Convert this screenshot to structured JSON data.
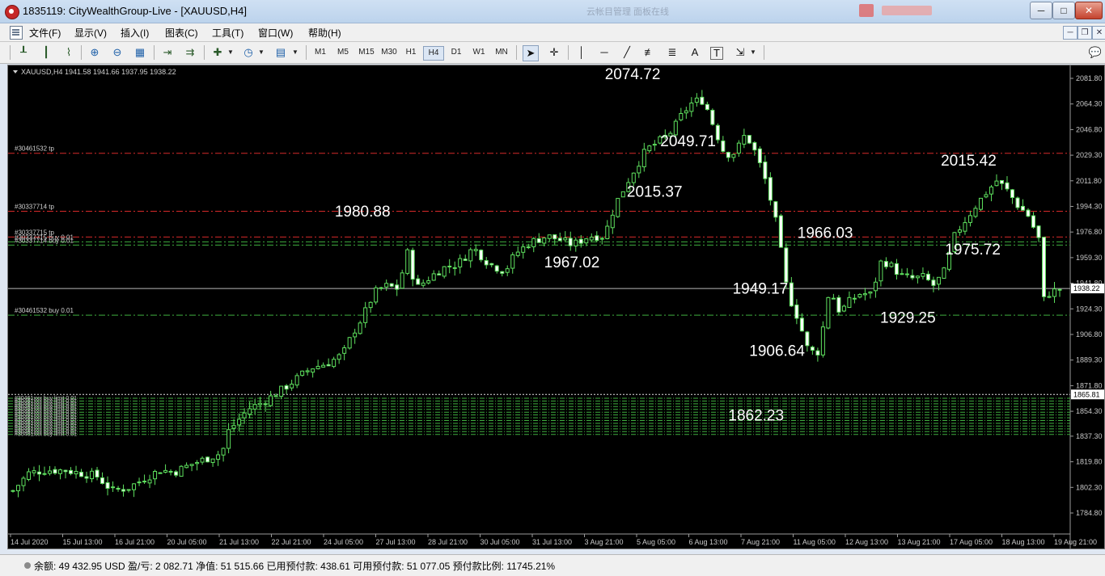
{
  "window": {
    "title": "1835119: CityWealthGroup-Live - [XAUUSD,H4]",
    "ghost_text": "云帐目管理  面板在线"
  },
  "menu": {
    "items": [
      "文件(F)",
      "显示(V)",
      "插入(I)",
      "图表(C)",
      "工具(T)",
      "窗口(W)",
      "帮助(H)"
    ]
  },
  "toolbar": {
    "timeframes": [
      "M1",
      "M5",
      "M15",
      "M30",
      "H1",
      "H4",
      "D1",
      "W1",
      "MN"
    ],
    "active_timeframe": "H4",
    "text_tool": "A",
    "text_label_tool": "T"
  },
  "chart": {
    "symbol_info": "XAUUSD,H4  1941.58 1941.66 1937.95 1938.22",
    "current_price": "1938.22",
    "current_price_value": 1938.22,
    "price_axis_labels": [
      "2081.80",
      "2064.30",
      "2046.80",
      "2029.30",
      "2011.80",
      "1994.30",
      "1976.80",
      "1959.30",
      "1941.80",
      "1924.30",
      "1906.80",
      "1889.30",
      "1871.80",
      "1854.30",
      "1837.30",
      "1819.80",
      "1802.30",
      "1784.80"
    ],
    "time_axis_labels": [
      "14 Jul 2020",
      "15 Jul 13:00",
      "16 Jul 21:00",
      "20 Jul 05:00",
      "21 Jul 13:00",
      "22 Jul 21:00",
      "24 Jul 05:00",
      "27 Jul 13:00",
      "28 Jul 21:00",
      "30 Jul 05:00",
      "31 Jul 13:00",
      "3 Aug 21:00",
      "5 Aug 05:00",
      "6 Aug 13:00",
      "7 Aug 21:00",
      "11 Aug 05:00",
      "12 Aug 13:00",
      "13 Aug 21:00",
      "17 Aug 05:00",
      "18 Aug 13:00",
      "19 Aug 21:00"
    ],
    "order_lines": [
      {
        "label": "#30461532 tp",
        "price": 2030.6,
        "color": "#d62a2a",
        "style": "dashdot"
      },
      {
        "label": "#30337714 tp",
        "price": 1991.0,
        "color": "#d62a2a",
        "style": "dashdot"
      },
      {
        "label": "#30337715 tp",
        "price": 1973.4,
        "color": "#d62a2a",
        "style": "dashdot"
      },
      {
        "label": "#30337715 buy 0.01",
        "price": 1970.1,
        "color": "#3fae3f",
        "style": "dashdot"
      },
      {
        "label": "#30337714 buy 0.01",
        "price": 1967.9,
        "color": "#3fae3f",
        "style": "dashdot"
      },
      {
        "label": "#30461532 buy 0.01",
        "price": 1920.0,
        "color": "#3fae3f",
        "style": "dashdot"
      }
    ],
    "pending_line_price": 1865.81,
    "pending_line_label": "1865.81",
    "limit_orders": {
      "label": "#30461xxx buy limit 0.01",
      "prices": [
        1863.2,
        1861.3,
        1859.4,
        1857.5,
        1855.6,
        1853.7,
        1851.8,
        1849.9,
        1848.0,
        1846.1,
        1844.2,
        1842.3,
        1840.4,
        1838.5
      ]
    },
    "annotations": [
      {
        "text": "2074.72",
        "price": 2074.72,
        "t": 0.592
      },
      {
        "text": "2049.71",
        "price": 2049.71,
        "t": 0.645
      },
      {
        "text": "2015.37",
        "price": 2015.37,
        "t": 0.613
      },
      {
        "text": "1980.88",
        "price": 1980.88,
        "t": 0.334
      },
      {
        "text": "1967.02",
        "price": 1967.02,
        "t": 0.534
      },
      {
        "text": "1966.03",
        "price": 1966.03,
        "t": 0.776
      },
      {
        "text": "1949.17",
        "price": 1949.17,
        "t": 0.714
      },
      {
        "text": "1906.64",
        "price": 1906.64,
        "t": 0.73
      },
      {
        "text": "1862.23",
        "price": 1862.23,
        "t": 0.71
      },
      {
        "text": "2015.42",
        "price": 2015.42,
        "t": 0.913
      },
      {
        "text": "1975.72",
        "price": 1975.72,
        "t": 0.917
      },
      {
        "text": "1929.25",
        "price": 1929.25,
        "t": 0.855
      }
    ]
  },
  "chart_data": {
    "type": "candlestick",
    "symbol": "XAUUSD",
    "timeframe": "H4",
    "ylim": [
      1784.8,
      2081.8
    ],
    "close_path": [
      [
        0.0,
        1800
      ],
      [
        0.015,
        1812
      ],
      [
        0.03,
        1814
      ],
      [
        0.05,
        1814
      ],
      [
        0.065,
        1812
      ],
      [
        0.08,
        1810
      ],
      [
        0.095,
        1800
      ],
      [
        0.11,
        1802
      ],
      [
        0.125,
        1808
      ],
      [
        0.14,
        1814
      ],
      [
        0.155,
        1813
      ],
      [
        0.17,
        1818
      ],
      [
        0.185,
        1822
      ],
      [
        0.2,
        1826
      ],
      [
        0.205,
        1840
      ],
      [
        0.215,
        1848
      ],
      [
        0.225,
        1856
      ],
      [
        0.24,
        1861
      ],
      [
        0.255,
        1868
      ],
      [
        0.27,
        1876
      ],
      [
        0.285,
        1884
      ],
      [
        0.3,
        1887
      ],
      [
        0.315,
        1893
      ],
      [
        0.325,
        1908
      ],
      [
        0.335,
        1920
      ],
      [
        0.345,
        1935
      ],
      [
        0.355,
        1940
      ],
      [
        0.37,
        1938
      ],
      [
        0.375,
        1968
      ],
      [
        0.385,
        1938
      ],
      [
        0.395,
        1944
      ],
      [
        0.41,
        1952
      ],
      [
        0.425,
        1955
      ],
      [
        0.44,
        1966
      ],
      [
        0.455,
        1955
      ],
      [
        0.47,
        1950
      ],
      [
        0.48,
        1962
      ],
      [
        0.495,
        1970
      ],
      [
        0.51,
        1974
      ],
      [
        0.52,
        1972
      ],
      [
        0.535,
        1968
      ],
      [
        0.55,
        1974
      ],
      [
        0.565,
        1974
      ],
      [
        0.575,
        1995
      ],
      [
        0.59,
        2015
      ],
      [
        0.605,
        2033
      ],
      [
        0.62,
        2040
      ],
      [
        0.63,
        2046
      ],
      [
        0.64,
        2058
      ],
      [
        0.65,
        2066
      ],
      [
        0.66,
        2067
      ],
      [
        0.67,
        2048
      ],
      [
        0.68,
        2030
      ],
      [
        0.69,
        2031
      ],
      [
        0.7,
        2044
      ],
      [
        0.71,
        2030
      ],
      [
        0.72,
        2010
      ],
      [
        0.73,
        1980
      ],
      [
        0.74,
        1935
      ],
      [
        0.75,
        1918
      ],
      [
        0.76,
        1895
      ],
      [
        0.77,
        1895
      ],
      [
        0.78,
        1938
      ],
      [
        0.79,
        1922
      ],
      [
        0.8,
        1930
      ],
      [
        0.81,
        1935
      ],
      [
        0.82,
        1934
      ],
      [
        0.83,
        1958
      ],
      [
        0.84,
        1953
      ],
      [
        0.85,
        1946
      ],
      [
        0.86,
        1945
      ],
      [
        0.87,
        1946
      ],
      [
        0.88,
        1940
      ],
      [
        0.89,
        1950
      ],
      [
        0.9,
        1975
      ],
      [
        0.91,
        1985
      ],
      [
        0.92,
        1995
      ],
      [
        0.93,
        2004
      ],
      [
        0.94,
        2012
      ],
      [
        0.95,
        2005
      ],
      [
        0.96,
        1995
      ],
      [
        0.97,
        1988
      ],
      [
        0.98,
        1972
      ],
      [
        0.985,
        1930
      ],
      [
        0.99,
        1935
      ],
      [
        1.0,
        1938
      ]
    ]
  },
  "statusbar": {
    "text": "余额: 49 432.95 USD  盈/亏: 2 082.71  净值: 51 515.66  已用预付款: 438.61  可用预付款: 51 077.05  预付款比例: 11745.21%"
  }
}
